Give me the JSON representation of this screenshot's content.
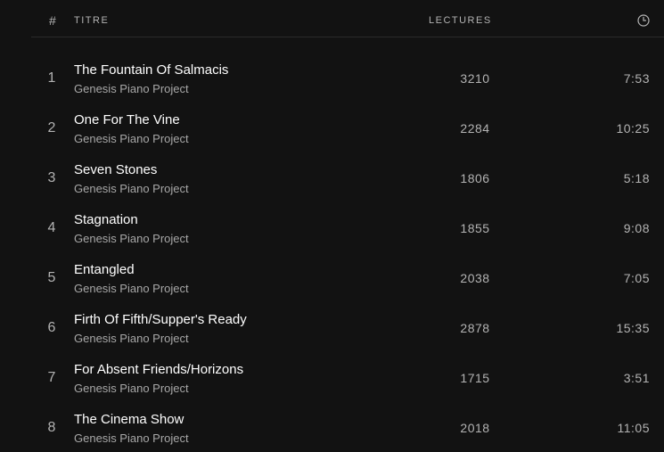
{
  "header": {
    "number": "#",
    "title": "TITRE",
    "plays": "LECTURES",
    "duration_icon": "clock-icon"
  },
  "tracks": [
    {
      "number": "1",
      "title": "The Fountain Of Salmacis",
      "artist": "Genesis Piano Project",
      "plays": "3210",
      "duration": "7:53"
    },
    {
      "number": "2",
      "title": "One For The Vine",
      "artist": "Genesis Piano Project",
      "plays": "2284",
      "duration": "10:25"
    },
    {
      "number": "3",
      "title": "Seven Stones",
      "artist": "Genesis Piano Project",
      "plays": "1806",
      "duration": "5:18"
    },
    {
      "number": "4",
      "title": "Stagnation",
      "artist": "Genesis Piano Project",
      "plays": "1855",
      "duration": "9:08"
    },
    {
      "number": "5",
      "title": "Entangled",
      "artist": "Genesis Piano Project",
      "plays": "2038",
      "duration": "7:05"
    },
    {
      "number": "6",
      "title": "Firth Of Fifth/Supper's Ready",
      "artist": "Genesis Piano Project",
      "plays": "2878",
      "duration": "15:35"
    },
    {
      "number": "7",
      "title": "For Absent Friends/Horizons",
      "artist": "Genesis Piano Project",
      "plays": "1715",
      "duration": "3:51"
    },
    {
      "number": "8",
      "title": "The Cinema Show",
      "artist": "Genesis Piano Project",
      "plays": "2018",
      "duration": "11:05"
    }
  ],
  "colors": {
    "background": "#121212",
    "title_text": "#ffffff",
    "secondary_text": "#b3b3b3"
  }
}
